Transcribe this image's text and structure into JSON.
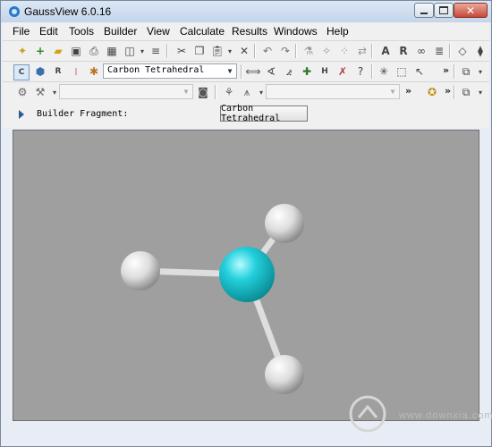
{
  "window": {
    "title": "GaussView 6.0.16",
    "controls": {
      "minimize": "0",
      "maximize": "1",
      "close": "r"
    }
  },
  "menu": [
    "File",
    "Edit",
    "Tools",
    "Builder",
    "View",
    "Calculate",
    "Results",
    "Windows",
    "Help"
  ],
  "toolbar2": {
    "fragment_combo": "Carbon Tetrahedral"
  },
  "toolbar3": {
    "combo_a": "",
    "combo_b": ""
  },
  "builder": {
    "label": "Builder Fragment:",
    "fragment_button": "Carbon Tetrahedral"
  },
  "molecule": {
    "atoms": [
      {
        "element": "C",
        "color": "#22d0dc"
      },
      {
        "element": "H",
        "color": "#e8e8e8"
      },
      {
        "element": "H",
        "color": "#e8e8e8"
      },
      {
        "element": "H",
        "color": "#e8e8e8"
      }
    ],
    "background_color": "#9f9f9f"
  },
  "overflow_chevron": "»",
  "watermark": "www.downxia.com"
}
